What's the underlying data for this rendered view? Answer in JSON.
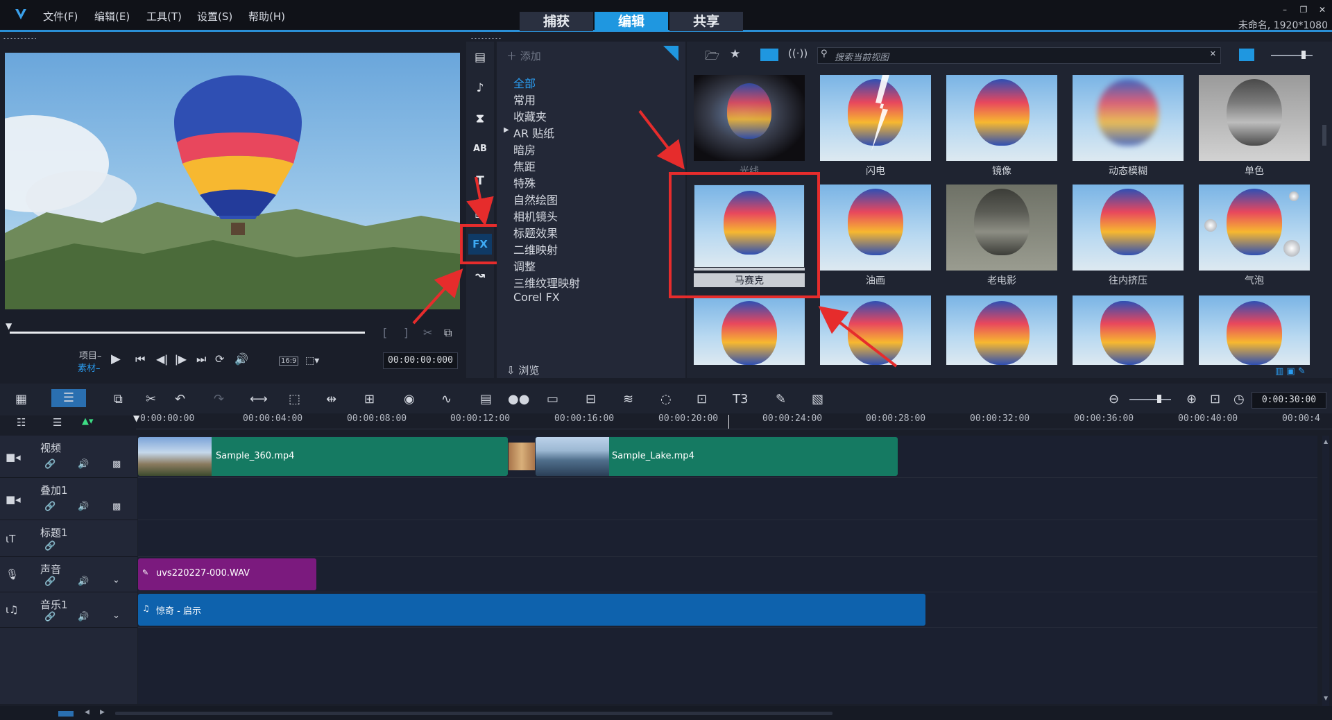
{
  "app": {
    "menu": [
      "文件(F)",
      "编辑(E)",
      "工具(T)",
      "设置(S)",
      "帮助(H)"
    ],
    "modes": [
      {
        "label": "捕获",
        "active": false
      },
      {
        "label": "编辑",
        "active": true
      },
      {
        "label": "共享",
        "active": false
      }
    ],
    "project_info": "未命名, 1920*1080",
    "accent": "#1f97e0"
  },
  "preview": {
    "mode_project": "项目",
    "mode_clip": "素材",
    "aspect": "16:9",
    "timecode": "00:00:00:000"
  },
  "library": {
    "add_label": "添加",
    "browse_label": "浏览",
    "search_placeholder": "搜索当前视图",
    "categories": [
      "全部",
      "常用",
      "收藏夹",
      "AR 贴纸",
      "暗房",
      "焦距",
      "特殊",
      "自然绘图",
      "相机镜头",
      "标题效果",
      "二维映射",
      "调整",
      "三维纹理映射",
      "Corel FX"
    ],
    "selected_category": "全部",
    "filters": [
      {
        "name": "光线"
      },
      {
        "name": "闪电"
      },
      {
        "name": "镜像"
      },
      {
        "name": "动态模糊"
      },
      {
        "name": "单色"
      },
      {
        "name": "马赛克"
      },
      {
        "name": "油画"
      },
      {
        "name": "老电影"
      },
      {
        "name": "往内挤压"
      },
      {
        "name": "气泡"
      },
      {
        "name": ""
      },
      {
        "name": ""
      },
      {
        "name": ""
      },
      {
        "name": ""
      },
      {
        "name": ""
      }
    ],
    "side_fx_label": "FX"
  },
  "timeline": {
    "duration": "0:00:30:00",
    "ruler": [
      "0:00:00:00",
      "00:00:04:00",
      "00:00:08:00",
      "00:00:12:00",
      "00:00:16:00",
      "00:00:20:00",
      "00:00:24:00",
      "00:00:28:00",
      "00:00:32:00",
      "00:00:36:00",
      "00:00:40:00",
      "00:00:4"
    ],
    "tracks": [
      {
        "name": "视频"
      },
      {
        "name": "叠加1"
      },
      {
        "name": "标题1"
      },
      {
        "name": "声音"
      },
      {
        "name": "音乐1"
      }
    ],
    "clips": {
      "video1": "Sample_360.mp4",
      "video2": "Sample_Lake.mp4",
      "voice": "uvs220227-000.WAV",
      "music": "惊奇 - 启示"
    }
  }
}
